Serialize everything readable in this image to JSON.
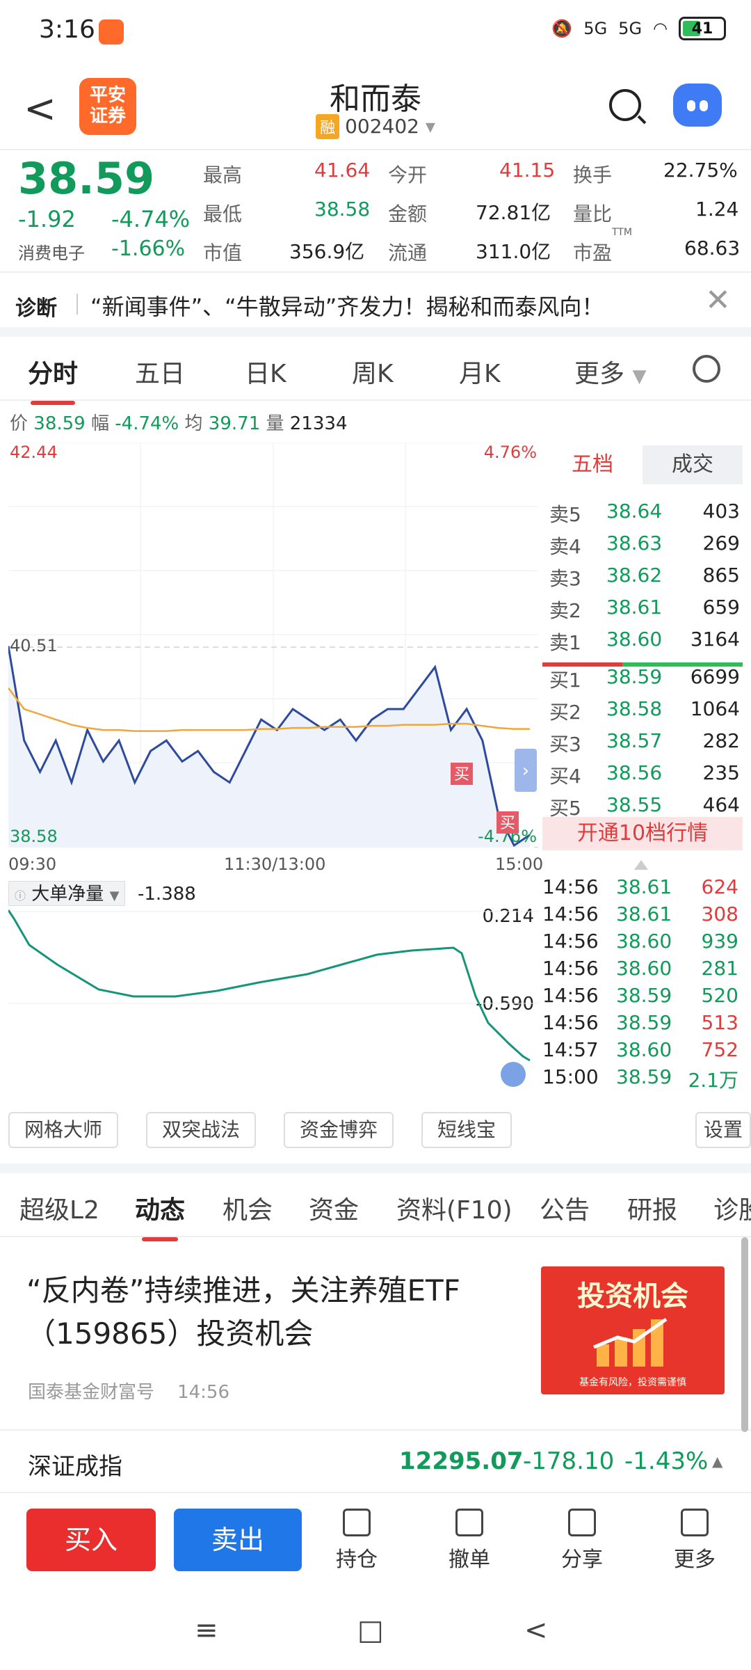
{
  "status": {
    "time": "3:16",
    "battery": "41",
    "net1": "5G",
    "net2": "5G"
  },
  "header": {
    "back": "<",
    "logo_l1": "平安",
    "logo_l2": "证券",
    "title": "和而泰",
    "badge": "融",
    "code": "002402"
  },
  "quote": {
    "price": "38.59",
    "change": "-1.92",
    "change_pct": "-4.74%",
    "sector": "消费电子",
    "sector_pct": "-1.66%",
    "high_label": "最高",
    "high": "41.64",
    "low_label": "最低",
    "low": "38.58",
    "mcap_label": "市值",
    "mcap": "356.9亿",
    "open_label": "今开",
    "open": "41.15",
    "amount_label": "金额",
    "amount": "72.81亿",
    "float_label": "流通",
    "float": "311.0亿",
    "turnover_label": "换手",
    "turnover": "22.75%",
    "vratio_label": "量比",
    "vratio": "1.24",
    "pe_label": "市盈",
    "pe_sup": "TTM",
    "pe": "68.63"
  },
  "diagnosis": {
    "label": "诊断",
    "text": "“新闻事件”、“牛散异动”齐发力！揭秘和而泰风向！",
    "close": "✕"
  },
  "tabs": [
    {
      "label": "分时"
    },
    {
      "label": "五日"
    },
    {
      "label": "日K"
    },
    {
      "label": "周K"
    },
    {
      "label": "月K"
    },
    {
      "label": "更多"
    }
  ],
  "infobar": {
    "p_label": "价",
    "p": "38.59",
    "f_label": "幅",
    "f": "-4.74%",
    "a_label": "均",
    "a": "39.71",
    "v_label": "量",
    "v": "21334"
  },
  "chart_data": {
    "type": "line",
    "ylim": [
      38.58,
      42.44
    ],
    "yticks_left": [
      "42.44",
      "40.51",
      "38.58"
    ],
    "yticks_right": [
      "4.76%",
      "-4.76%"
    ],
    "xticks": [
      "09:30",
      "11:30/13:00",
      "15:00"
    ],
    "series": [
      {
        "values": [
          40.5,
          39.6,
          39.3,
          39.6,
          39.2,
          39.7,
          39.4,
          39.6,
          39.2,
          39.5,
          39.6,
          39.4,
          39.5,
          39.3,
          39.2,
          39.5,
          39.8,
          39.7,
          39.9,
          39.8,
          39.7,
          39.8,
          39.6,
          39.8,
          39.9,
          39.9,
          40.1,
          40.3,
          39.7,
          39.9,
          39.6,
          38.9,
          38.6,
          38.7
        ]
      },
      {
        "values": [
          40.1,
          39.9,
          39.85,
          39.8,
          39.75,
          39.72,
          39.7,
          39.7,
          39.69,
          39.69,
          39.69,
          39.7,
          39.7,
          39.7,
          39.7,
          39.7,
          39.71,
          39.71,
          39.72,
          39.72,
          39.73,
          39.73,
          39.73,
          39.74,
          39.74,
          39.75,
          39.75,
          39.75,
          39.76,
          39.76,
          39.74,
          39.72,
          39.71,
          39.71
        ]
      }
    ]
  },
  "flow": {
    "label": "大单净量",
    "value": "-1.388",
    "top": "0.214",
    "mid": "-0.590"
  },
  "orderbook": {
    "tabs": [
      "五档",
      "成交"
    ],
    "asks": [
      {
        "label": "卖5",
        "price": "38.64",
        "vol": "403"
      },
      {
        "label": "卖4",
        "price": "38.63",
        "vol": "269"
      },
      {
        "label": "卖3",
        "price": "38.62",
        "vol": "865"
      },
      {
        "label": "卖2",
        "price": "38.61",
        "vol": "659"
      },
      {
        "label": "卖1",
        "price": "38.60",
        "vol": "3164"
      }
    ],
    "bids": [
      {
        "label": "买1",
        "price": "38.59",
        "vol": "6699"
      },
      {
        "label": "买2",
        "price": "38.58",
        "vol": "1064"
      },
      {
        "label": "买3",
        "price": "38.57",
        "vol": "282"
      },
      {
        "label": "买4",
        "price": "38.56",
        "vol": "235"
      },
      {
        "label": "买5",
        "price": "38.55",
        "vol": "464"
      }
    ],
    "upgrade": "开通10档行情"
  },
  "trades": [
    {
      "t": "14:56",
      "p": "38.61",
      "v": "624",
      "dir": "up"
    },
    {
      "t": "14:56",
      "p": "38.61",
      "v": "308",
      "dir": "up"
    },
    {
      "t": "14:56",
      "p": "38.60",
      "v": "939",
      "dir": "down"
    },
    {
      "t": "14:56",
      "p": "38.60",
      "v": "281",
      "dir": "down"
    },
    {
      "t": "14:56",
      "p": "38.59",
      "v": "520",
      "dir": "down"
    },
    {
      "t": "14:56",
      "p": "38.59",
      "v": "513",
      "dir": "up"
    },
    {
      "t": "14:57",
      "p": "38.60",
      "v": "752",
      "dir": "up"
    },
    {
      "t": "15:00",
      "p": "38.59",
      "v": "2.1万",
      "dir": "down"
    }
  ],
  "tools": [
    "网格大师",
    "双突战法",
    "资金博弈",
    "短线宝",
    "设置"
  ],
  "tabs2": [
    "超级L2",
    "动态",
    "机会",
    "资金",
    "资料(F10)",
    "公告",
    "研报",
    "诊股"
  ],
  "news": {
    "title": "“反内卷”持续推进，关注养殖ETF（159865）投资机会",
    "source": "国泰基金财富号",
    "time": "14:56",
    "img_title": "投资机会",
    "img_foot": "基金有风险，投资需谨慎"
  },
  "index": {
    "name": "深证成指",
    "value": "12295.07",
    "change": "-178.10",
    "pct": "-1.43%"
  },
  "actions": {
    "buy": "买入",
    "sell": "卖出",
    "hold": "持仓",
    "cancel": "撤单",
    "share": "分享",
    "more": "更多"
  },
  "nav": {
    "menu": "≡",
    "home": "□",
    "back": "<"
  }
}
